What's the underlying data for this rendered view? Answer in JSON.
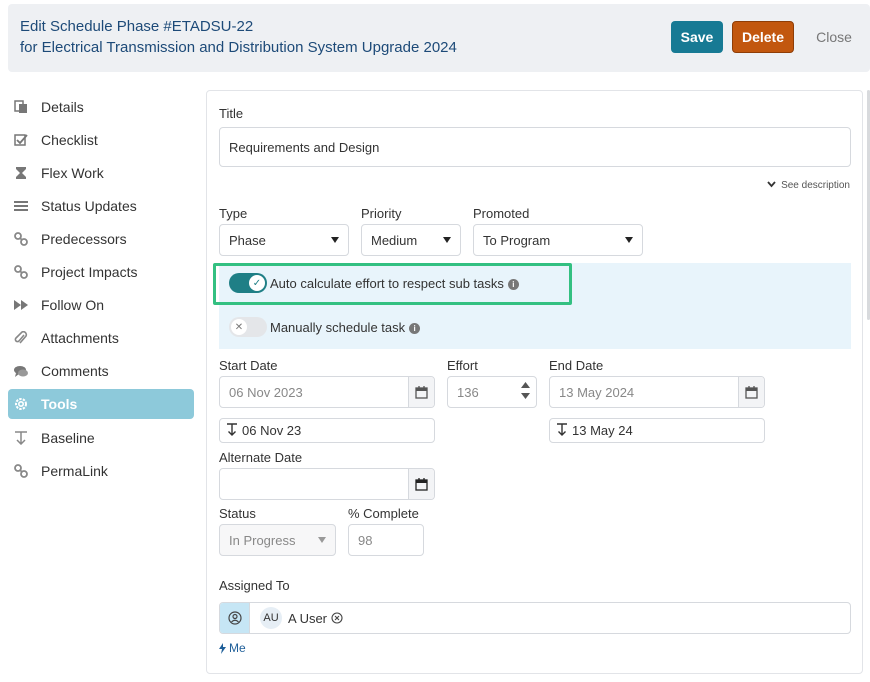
{
  "header": {
    "title_line1": "Edit Schedule Phase #ETADSU-22",
    "title_line2": "for Electrical Transmission and Distribution System Upgrade 2024",
    "save_label": "Save",
    "delete_label": "Delete",
    "close_label": "Close"
  },
  "sidebar": {
    "items": [
      {
        "label": "Details",
        "icon": "document-icon"
      },
      {
        "label": "Checklist",
        "icon": "checklist-icon"
      },
      {
        "label": "Flex Work",
        "icon": "hourglass-icon"
      },
      {
        "label": "Status Updates",
        "icon": "list-icon"
      },
      {
        "label": "Predecessors",
        "icon": "link-icon"
      },
      {
        "label": "Project Impacts",
        "icon": "link-icon"
      },
      {
        "label": "Follow On",
        "icon": "fast-forward-icon"
      },
      {
        "label": "Attachments",
        "icon": "paperclip-icon"
      },
      {
        "label": "Comments",
        "icon": "comments-icon"
      },
      {
        "label": "Tools",
        "icon": "gear-icon",
        "active": true
      },
      {
        "label": "Baseline",
        "icon": "baseline-icon"
      },
      {
        "label": "PermaLink",
        "icon": "link-icon"
      }
    ]
  },
  "form": {
    "title_label": "Title",
    "title_value": "Requirements and Design",
    "see_description": "See description",
    "type_label": "Type",
    "type_value": "Phase",
    "priority_label": "Priority",
    "priority_value": "Medium",
    "promoted_label": "Promoted",
    "promoted_value": "To Program",
    "auto_calc_label": "Auto calculate effort to respect sub tasks",
    "auto_calc_on": true,
    "manual_schedule_label": "Manually schedule task",
    "manual_schedule_on": false,
    "start_date_label": "Start Date",
    "start_date_value": "06 Nov 2023",
    "start_baseline": "06 Nov 23",
    "effort_label": "Effort",
    "effort_value": "136",
    "end_date_label": "End Date",
    "end_date_value": "13 May 2024",
    "end_baseline": "13 May 24",
    "alternate_date_label": "Alternate Date",
    "alternate_date_value": "",
    "status_label": "Status",
    "status_value": "In Progress",
    "complete_label": "% Complete",
    "complete_value": "98",
    "assigned_label": "Assigned To",
    "assignee_initials": "AU",
    "assignee_name": "A User",
    "me_link": "Me"
  },
  "colors": {
    "accent": "#177a94",
    "delete": "#c2570e",
    "toggle_on": "#1f7f86",
    "highlight": "#33c081",
    "active_nav": "#8dc9da"
  }
}
